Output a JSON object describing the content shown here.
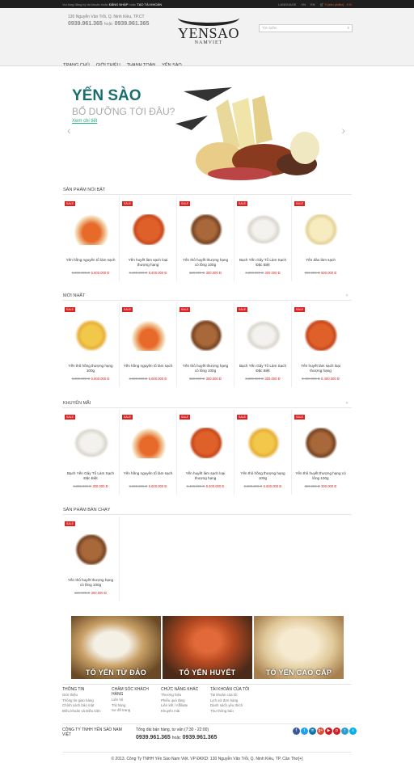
{
  "topbar": {
    "left_prefix": "Vui lòng đăng ký tài khoản hoặc",
    "login": "ĐĂNG NHẬP",
    "or": "hoặc",
    "register": "TẠO TÀI KHOẢN",
    "lang_label": "LANGUAGE",
    "lang_vi": "VN",
    "lang_en": "EN",
    "cart": "0 (sản phẩm) - 0 Đ"
  },
  "header": {
    "address": "130 Nguyễn Văn Trỗi, Q. Ninh Kiều, TP.CT",
    "phone1": "0939.961.365",
    "or": "hoặc",
    "phone2": "0939.961.365",
    "logo_brand": "YENSAO",
    "logo_sub": "NAMVIET",
    "search_placeholder": "Tìm kiếm"
  },
  "nav": [
    "TRANG CHỦ",
    "GIỚI THIỆU",
    "THANH TOÁN",
    "YẾN SÀO"
  ],
  "banner": {
    "title": "YẾN SÀO",
    "subtitle": "BỔ DƯỠNG TỚI ĐÂU?",
    "more": "Xem chi tiết"
  },
  "colors": {
    "sale": "#dd2222",
    "accent": "#1a6e6e"
  },
  "sections": [
    {
      "title": "SẢN PHẨM NỔI BẬT",
      "products": [
        {
          "sale": "SALE",
          "name": "Yến hồng nguyên tổ làm sạch",
          "old": "6.800.000 Đ",
          "new": "5.600.000 Đ",
          "kind": "orange-bowl"
        },
        {
          "sale": "SALE",
          "name": "Yến huyết làm sạch loại thượng hạng",
          "old": "9.400.000 Đ",
          "new": "8.400.000 Đ",
          "kind": "red-box"
        },
        {
          "sale": "SALE",
          "name": "Yến thô huyết thượng hạng có lông 100g",
          "old": "320.000 Đ",
          "new": "300.000 Đ",
          "kind": "brown-box"
        },
        {
          "sale": "SALE",
          "name": "Bạch Yến Gây Tổ Làm Sạch Đặc Biệt",
          "old": "3.200.000 Đ",
          "new": "300.000 Đ",
          "kind": "white"
        },
        {
          "sale": "SALE",
          "name": "Yến đảo làm sạch",
          "old": "900.000 Đ",
          "new": "800.000 Đ",
          "kind": "cream"
        }
      ]
    },
    {
      "title": "MỚI NHẤT",
      "products": [
        {
          "sale": "SALE",
          "name": "Yến thô hồng thượng hạng 100g",
          "old": "6.800.000 Đ",
          "new": "5.600.000 Đ",
          "kind": "yellow"
        },
        {
          "sale": "SALE",
          "name": "Yến hồng nguyên tổ làm sạch",
          "old": "6.800.000 Đ",
          "new": "5.600.000 Đ",
          "kind": "orange-bowl"
        },
        {
          "sale": "SALE",
          "name": "Yến thô huyết thượng hạng có lông 100g",
          "old": "320.000 Đ",
          "new": "300.000 Đ",
          "kind": "brown-box"
        },
        {
          "sale": "SALE",
          "name": "Bạch Yến Gây Tổ Làm Sạch Đặc Biệt",
          "old": "3.200.000 Đ",
          "new": "300.000 Đ",
          "kind": "white"
        },
        {
          "sale": "SALE",
          "name": "Yến huyết làm sạch loại thượng hạng",
          "old": "9.400.000 Đ",
          "new": "8.400.000 Đ",
          "kind": "red-box"
        }
      ]
    },
    {
      "title": "KHUYẾN MÃI",
      "products": [
        {
          "sale": "SALE",
          "name": "Bạch Yến Gây Tổ Làm Sạch Đặc Biệt",
          "old": "3.200.000 Đ",
          "new": "300.000 Đ",
          "kind": "white"
        },
        {
          "sale": "SALE",
          "name": "Yến hồng nguyên tổ làm sạch",
          "old": "6.800.000 Đ",
          "new": "5.600.000 Đ",
          "kind": "orange-bowl"
        },
        {
          "sale": "SALE",
          "name": "Yến huyết làm sạch loại thượng hạng",
          "old": "9.400.000 Đ",
          "new": "8.400.000 Đ",
          "kind": "red-box"
        },
        {
          "sale": "SALE",
          "name": "Yến thô hồng thượng hạng 100g",
          "old": "6.800.000 Đ",
          "new": "5.600.000 Đ",
          "kind": "yellow"
        },
        {
          "sale": "SALE",
          "name": "Yến thô huyết thượng hạng có lông 100g",
          "old": "320.000 Đ",
          "new": "300.000 Đ",
          "kind": "brown-box"
        }
      ]
    },
    {
      "title": "SẢN PHẨM BÁN CHẠY",
      "products": [
        {
          "sale": "SALE",
          "name": "Yến thô huyết thượng hạng có lông 100g",
          "old": "320.000 Đ",
          "new": "300.000 Đ",
          "kind": "brown-box"
        }
      ]
    }
  ],
  "promos": [
    "TỔ YẾN TỪ ĐẢO",
    "TỔ YẾN HUYẾT",
    "TỔ YẾN CAO CẤP"
  ],
  "footer": {
    "cols": [
      {
        "title": "THÔNG TIN",
        "items": [
          "Giới thiệu",
          "Thông tin giao hàng",
          "Chính sách bảo mật",
          "Điều khoản và Điều kiện"
        ]
      },
      {
        "title": "CHĂM SÓC KHÁCH HÀNG",
        "items": [
          "Liên hệ",
          "Trả hàng",
          "Sơ đồ trang"
        ]
      },
      {
        "title": "CHỨC NĂNG KHÁC",
        "items": [
          "Thương hiệu",
          "Phiếu quà tặng",
          "Liên kết / Affiliate",
          "Khuyến mãi"
        ]
      },
      {
        "title": "TÀI KHOẢN CỦA TÔI",
        "items": [
          "Tài khoản của tôi",
          "Lịch sử đơn hàng",
          "Danh sách yêu thích",
          "Thư thông báo"
        ]
      }
    ],
    "company": "CÔNG TY TNHH YẾN SÀO NAM VIỆT",
    "hotline_label": "Tổng đài bán hàng, tư vấn (7:30 - 22:00)",
    "phone1": "0939.961.365",
    "or": "hoặc",
    "phone2": "0939.961.365",
    "copyright": "© 2013. Công Ty TNHH Yến Sào Nam Việt. VP ĐKKD: 130 Nguyễn Văn Trỗi, Q. Ninh Kiều, TP. Cần Thơ[+]"
  },
  "social": [
    {
      "icon": "facebook-icon",
      "glyph": "f",
      "color": "#3b5998"
    },
    {
      "icon": "twitter-icon",
      "glyph": "t",
      "color": "#1da1f2"
    },
    {
      "icon": "linkedin-icon",
      "glyph": "in",
      "color": "#0e76a8"
    },
    {
      "icon": "google-plus-icon",
      "glyph": "g+",
      "color": "#dd4b39"
    },
    {
      "icon": "youtube-icon",
      "glyph": "▶",
      "color": "#cc181e"
    },
    {
      "icon": "pinterest-icon",
      "glyph": "p",
      "color": "#cb2027"
    },
    {
      "icon": "rss-icon",
      "glyph": "r",
      "color": "#2a9fd6"
    },
    {
      "icon": "skype-icon",
      "glyph": "s",
      "color": "#00aff0"
    }
  ]
}
